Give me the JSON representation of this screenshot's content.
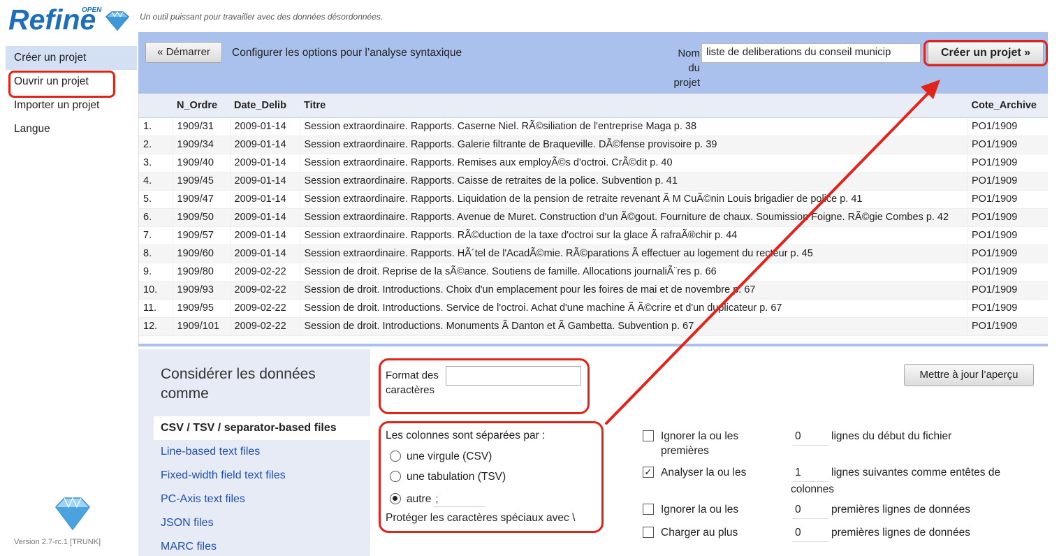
{
  "app": {
    "logo_text": "Refine",
    "logo_open": "OPEN",
    "tagline": "Un outil puissant pour travailler avec des données désordonnées.",
    "version": "Version 2.7-rc.1 [TRUNK]"
  },
  "left_menu": {
    "items": [
      {
        "label": "Créer un projet"
      },
      {
        "label": "Ouvrir un projet"
      },
      {
        "label": "Importer un projet"
      },
      {
        "label": "Langue"
      }
    ]
  },
  "header": {
    "start_button": "« Démarrer",
    "config_label": "Configurer les options pour l’analyse syntaxique",
    "project_name_label": "Nom du projet",
    "project_name_value": "liste de deliberations du conseil municip",
    "create_button": "Créer un projet »"
  },
  "table": {
    "columns": [
      "",
      "N_Ordre",
      "Date_Delib",
      "Titre",
      "Cote_Archive"
    ],
    "rows": [
      {
        "idx": "1.",
        "ordre": "1909/31",
        "date": "2009-01-14",
        "titre": "Session extraordinaire. Rapports. Caserne Niel. RÃ©siliation de l'entreprise Maga p. 38",
        "cote": "PO1/1909"
      },
      {
        "idx": "2.",
        "ordre": "1909/34",
        "date": "2009-01-14",
        "titre": "Session extraordinaire. Rapports. Galerie filtrante de Braqueville. DÃ©fense provisoire p. 39",
        "cote": "PO1/1909"
      },
      {
        "idx": "3.",
        "ordre": "1909/40",
        "date": "2009-01-14",
        "titre": "Session extraordinaire. Rapports. Remises aux employÃ©s d'octroi. CrÃ©dit p. 40",
        "cote": "PO1/1909"
      },
      {
        "idx": "4.",
        "ordre": "1909/45",
        "date": "2009-01-14",
        "titre": "Session extraordinaire. Rapports. Caisse de retraites de la police. Subvention p. 41",
        "cote": "PO1/1909"
      },
      {
        "idx": "5.",
        "ordre": "1909/47",
        "date": "2009-01-14",
        "titre": "Session extraordinaire. Rapports. Liquidation de la pension de retraite revenant Ã  M CuÃ©nin Louis brigadier de police p. 41",
        "cote": "PO1/1909"
      },
      {
        "idx": "6.",
        "ordre": "1909/50",
        "date": "2009-01-14",
        "titre": "Session extraordinaire. Rapports. Avenue de Muret. Construction d'un Ã©gout. Fourniture de chaux. Soumission Foigne. RÃ©gie Combes p. 42",
        "cote": "PO1/1909"
      },
      {
        "idx": "7.",
        "ordre": "1909/57",
        "date": "2009-01-14",
        "titre": "Session extraordinaire. Rapports. RÃ©duction de la taxe d'octroi sur la glace Ã  rafraÃ®chir p. 44",
        "cote": "PO1/1909"
      },
      {
        "idx": "8.",
        "ordre": "1909/60",
        "date": "2009-01-14",
        "titre": "Session extraordinaire. Rapports. HÃ´tel de l'AcadÃ©mie. RÃ©parations Ã  effectuer au logement du recteur p. 45",
        "cote": "PO1/1909"
      },
      {
        "idx": "9.",
        "ordre": "1909/80",
        "date": "2009-02-22",
        "titre": "Session de droit. Reprise de la sÃ©ance. Soutiens de famille. Allocations journaliÃ¨res p. 66",
        "cote": "PO1/1909"
      },
      {
        "idx": "10.",
        "ordre": "1909/93",
        "date": "2009-02-22",
        "titre": "Session de droit. Introductions. Choix d'un emplacement pour les foires de mai et de novembre p. 67",
        "cote": "PO1/1909"
      },
      {
        "idx": "11.",
        "ordre": "1909/95",
        "date": "2009-02-22",
        "titre": "Session de droit. Introductions. Service de l'octroi. Achat d'une machine Ã  Ã©crire et d'un duplicateur p. 67",
        "cote": "PO1/1909"
      },
      {
        "idx": "12.",
        "ordre": "1909/101",
        "date": "2009-02-22",
        "titre": "Session de droit. Introductions. Monuments Ã  Danton et Ã  Gambetta. Subvention p. 67",
        "cote": "PO1/1909"
      }
    ]
  },
  "formats": {
    "title": "Considérer les données comme",
    "items": [
      {
        "label": "CSV / TSV / separator-based files"
      },
      {
        "label": "Line-based text files"
      },
      {
        "label": "Fixed-width field text files"
      },
      {
        "label": "PC-Axis text files"
      },
      {
        "label": "JSON files"
      },
      {
        "label": "MARC files"
      }
    ]
  },
  "options": {
    "encoding_label": "Format des caractères",
    "encoding_value": "",
    "separator_title": "Les colonnes sont séparées par :",
    "radio_csv": "une virgule (CSV)",
    "radio_tsv": "une tabulation (TSV)",
    "radio_other": "autre",
    "other_value": ";",
    "protect_label": "Protéger les caractères spéciaux avec \\",
    "update_button": "Mettre à jour l’aperçu",
    "ignore_first": {
      "label": "Ignorer la ou les premières",
      "value": "0",
      "after": "lignes du début du fichier",
      "checked": false
    },
    "header_lines": {
      "label": "Analyser la ou les",
      "value": "1",
      "after": "lignes suivantes comme entêtes de",
      "after_wrap": "colonnes",
      "checked": true
    },
    "skip_data": {
      "label": "Ignorer la ou les",
      "value": "0",
      "after": "premières lignes de données",
      "checked": false
    },
    "limit_load": {
      "label": "Charger au plus",
      "value": "0",
      "after": "premières lignes de données",
      "checked": false
    }
  },
  "colors": {
    "header_bg": "#a9c1ec",
    "annotation_red": "#e2231a",
    "link_blue": "#1e50b4"
  }
}
